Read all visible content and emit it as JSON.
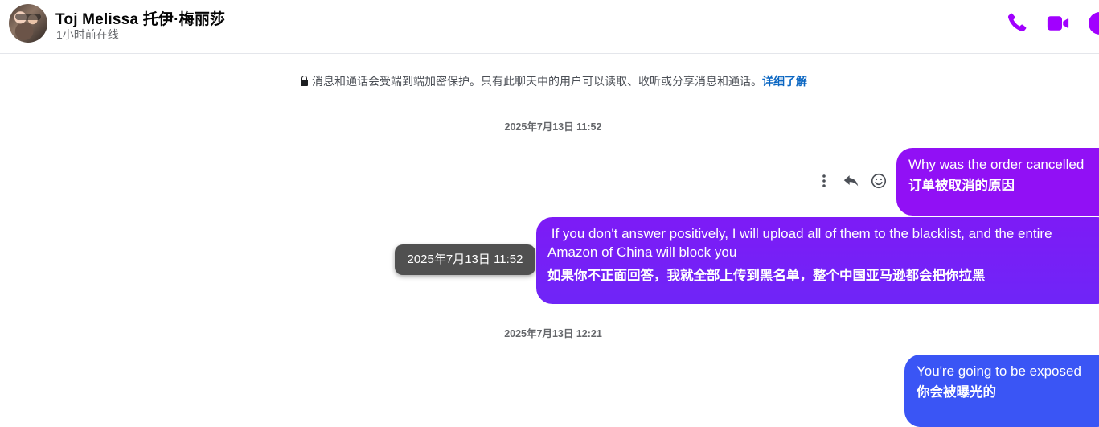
{
  "header": {
    "contact_name": "Toj Melissa  托伊·梅丽莎",
    "status": "1小时前在线"
  },
  "notice": {
    "text": "消息和通话会受端到端加密保护。只有此聊天中的用户可以读取、收听或分享消息和通话。",
    "link": "详细了解"
  },
  "messages": [
    {
      "timestamp": "2025年7月13日 11:52",
      "en": "Why was the order cancelled",
      "zh": "订单被取消的原因",
      "color": "#9110f5"
    },
    {
      "en": " If you don't answer positively, I will upload all of them to the blacklist, and the entire Amazon of China will block you",
      "zh": "如果你不正面回答，我就全部上传到黑名单，整个中国亚马逊都会把你拉黑",
      "color": "#7122f7"
    },
    {
      "timestamp": "2025年7月13日 12:21",
      "en": "You're going to be exposed",
      "zh": "你会被曝光的",
      "color": "#3a55f5"
    }
  ],
  "tooltip": "2025年7月13日 11:52",
  "colors": {
    "accent": "#a100ff",
    "link": "#0a66c2"
  },
  "icons": {
    "call": "phone-icon",
    "video": "video-camera-icon",
    "info": "info-icon",
    "more": "more-vertical-icon",
    "reply": "reply-arrow-icon",
    "react": "smiley-face-icon",
    "lock": "lock-icon"
  }
}
